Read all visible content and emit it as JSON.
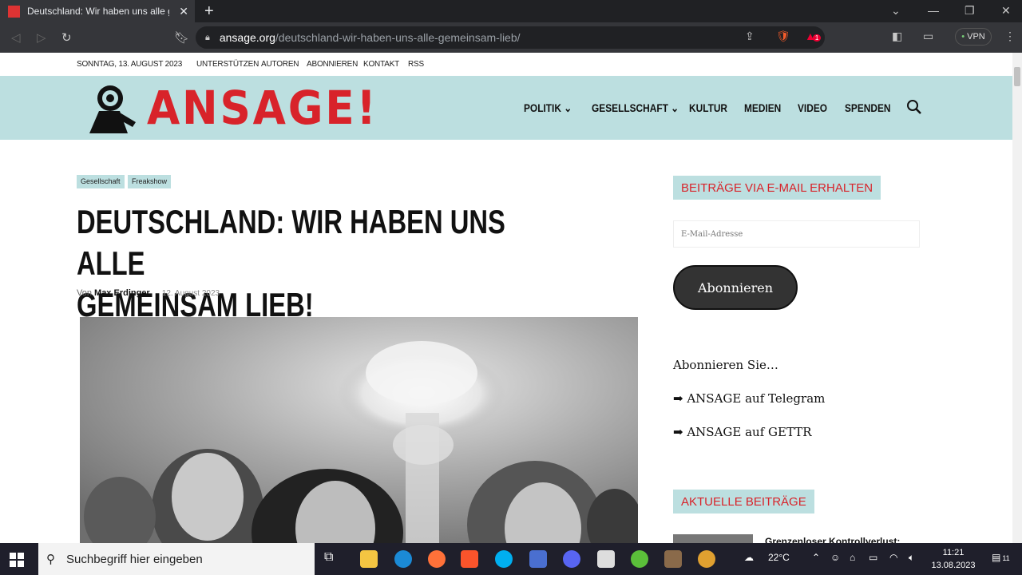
{
  "browser": {
    "tab_title": "Deutschland: Wir haben uns alle gemeinsam lieb",
    "url_domain": "ansage.org",
    "url_path": "/deutschland-wir-haben-uns-alle-gemeinsam-lieb/",
    "vpn_label": "VPN",
    "brave_badge": "1"
  },
  "topbar": {
    "date": "SONNTAG, 13. AUGUST 2023",
    "links": [
      "UNTERSTÜTZEN",
      "AUTOREN",
      "ABONNIEREN",
      "KONTAKT",
      "RSS"
    ]
  },
  "site": {
    "logo_text": "ANSAGE!",
    "logo_color": "#d8232a",
    "header_bg": "#bcdfe0",
    "nav": [
      "POLITIK ⌄",
      "GESELLSCHAFT ⌄",
      "KULTUR",
      "MEDIEN",
      "VIDEO",
      "SPENDEN"
    ]
  },
  "article": {
    "categories": [
      "Gesellschaft",
      "Freakshow"
    ],
    "headline_line1": "DEUTSCHLAND: WIR HABEN UNS ALLE",
    "headline_line2": "GEMEINSAM LIEB!",
    "byline_prefix": "Von",
    "author": "Max Erdinger",
    "date": "12. August 2023"
  },
  "sidebar": {
    "email_title": "BEITRÄGE VIA E-MAIL ERHALTEN",
    "email_placeholder": "E-Mail-Adresse",
    "subscribe_button": "Abonnieren",
    "subscribe_text": "Abonnieren Sie…",
    "telegram_link": "➡ ANSAGE auf Telegram",
    "gettr_link": "➡ ANSAGE auf GETTR",
    "recent_title": "AKTUELLE BEITRÄGE",
    "recent_first": "Grenzenloser Kontrollverlust:"
  },
  "taskbar": {
    "search_placeholder": "Suchbegriff hier eingeben",
    "weather": "22°C",
    "time": "11:21",
    "date": "13.08.2023",
    "notifications": "11"
  }
}
